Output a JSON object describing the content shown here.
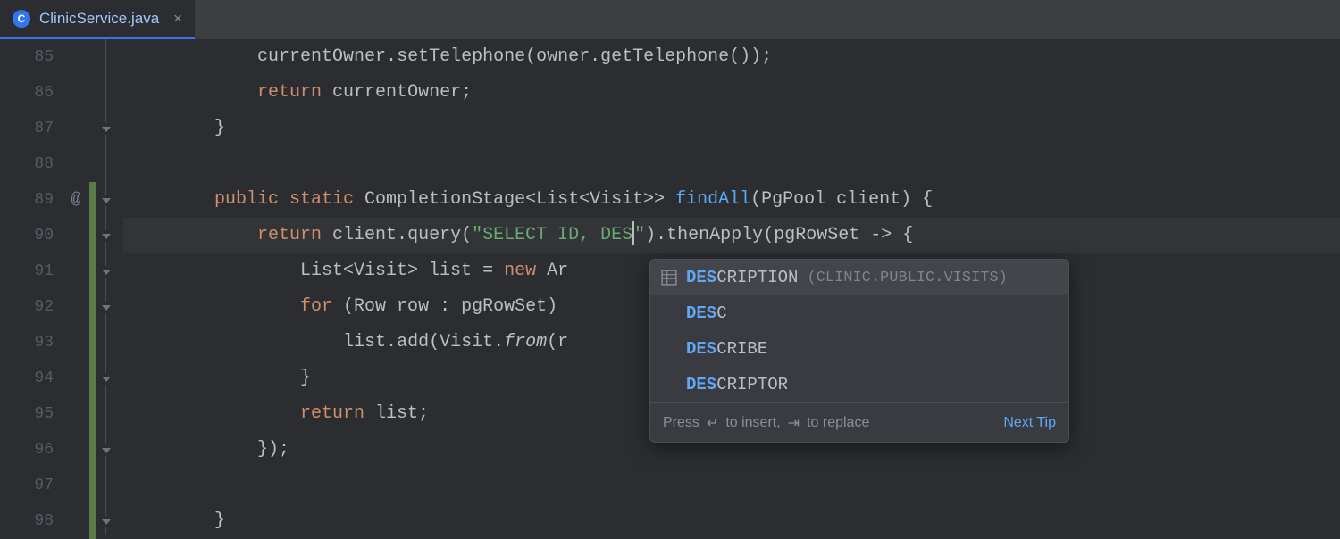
{
  "tab": {
    "label": "ClinicService.java",
    "icon_letter": "C"
  },
  "gutter": {
    "start": 85,
    "end": 98,
    "annotation_line": 89,
    "annotation_symbol": "@"
  },
  "code_lines": [
    [
      {
        "t": "            currentOwner.",
        "c": "ident"
      },
      {
        "t": "setTelephone",
        "c": "mcall"
      },
      {
        "t": "(owner.",
        "c": "ident"
      },
      {
        "t": "getTelephone",
        "c": "mcall"
      },
      {
        "t": "());",
        "c": "punc"
      }
    ],
    [
      {
        "t": "            ",
        "c": ""
      },
      {
        "t": "return",
        "c": "kw"
      },
      {
        "t": " currentOwner;",
        "c": "ident"
      }
    ],
    [
      {
        "t": "        }",
        "c": "punc"
      }
    ],
    [],
    [
      {
        "t": "        ",
        "c": ""
      },
      {
        "t": "public static",
        "c": "kw"
      },
      {
        "t": " CompletionStage<List<Visit>> ",
        "c": "type"
      },
      {
        "t": "findAll",
        "c": "method"
      },
      {
        "t": "(PgPool client) {",
        "c": "ident"
      }
    ],
    [
      {
        "t": "            ",
        "c": ""
      },
      {
        "t": "return",
        "c": "kw"
      },
      {
        "t": " client.",
        "c": "ident"
      },
      {
        "t": "query",
        "c": "mcall"
      },
      {
        "t": "(",
        "c": "punc"
      },
      {
        "t": "\"SELECT ID, DES",
        "c": "str"
      },
      {
        "t": "",
        "c": "caret"
      },
      {
        "t": "\"",
        "c": "str"
      },
      {
        "t": ").",
        "c": "punc"
      },
      {
        "t": "thenApply",
        "c": "mcall"
      },
      {
        "t": "(pgRowSet -> {",
        "c": "lambda"
      }
    ],
    [
      {
        "t": "                List<Visit> list = ",
        "c": "ident"
      },
      {
        "t": "new",
        "c": "kw"
      },
      {
        "t": " Ar",
        "c": "ident"
      }
    ],
    [
      {
        "t": "                ",
        "c": ""
      },
      {
        "t": "for",
        "c": "kw"
      },
      {
        "t": " (Row row : pgRowSet) ",
        "c": "ident"
      }
    ],
    [
      {
        "t": "                    list.",
        "c": "ident"
      },
      {
        "t": "add",
        "c": "mcall"
      },
      {
        "t": "(Visit.",
        "c": "ident"
      },
      {
        "t": "from",
        "c": "ital"
      },
      {
        "t": "(r",
        "c": "ident"
      }
    ],
    [
      {
        "t": "                }",
        "c": "punc"
      }
    ],
    [
      {
        "t": "                ",
        "c": ""
      },
      {
        "t": "return",
        "c": "kw"
      },
      {
        "t": " list;",
        "c": "ident"
      }
    ],
    [
      {
        "t": "            });",
        "c": "punc"
      }
    ],
    [],
    [
      {
        "t": "        }",
        "c": "punc"
      }
    ]
  ],
  "current_line_index": 5,
  "fold_markers_at": [
    2,
    4,
    5,
    6,
    7,
    9,
    11,
    13
  ],
  "change_marks": [
    {
      "from": 4,
      "to": 13
    }
  ],
  "autocomplete": {
    "items": [
      {
        "match": "DES",
        "rest": "CRIPTION",
        "context": "(CLINIC.PUBLIC.VISITS)",
        "icon": "column",
        "selected": true
      },
      {
        "match": "DES",
        "rest": "C",
        "context": "",
        "icon": "",
        "selected": false
      },
      {
        "match": "DES",
        "rest": "CRIBE",
        "context": "",
        "icon": "",
        "selected": false
      },
      {
        "match": "DES",
        "rest": "CRIPTOR",
        "context": "",
        "icon": "",
        "selected": false
      }
    ],
    "hint_prefix": "Press ",
    "hint_insert": " to insert, ",
    "hint_replace": " to replace",
    "enter_glyph": "↵",
    "tab_glyph": "⇥",
    "next_tip": "Next Tip"
  }
}
